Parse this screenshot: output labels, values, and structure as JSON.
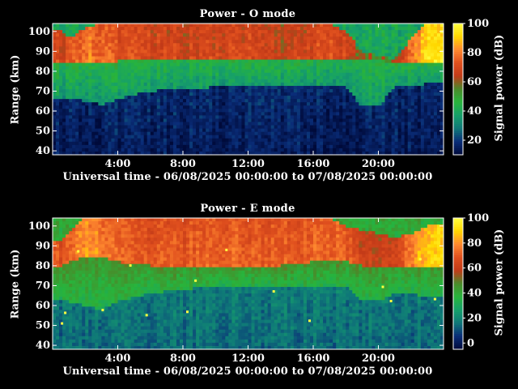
{
  "chart_data": [
    {
      "type": "heatmap",
      "title": "Power - O mode",
      "xlabel": "Universal time - 06/08/2025 00:00:00 to 07/08/2025 00:00:00",
      "ylabel": "Range (km)",
      "colorbar_label": "Signal power (dB)",
      "x_ticks": [
        "4:00",
        "8:00",
        "12:00",
        "16:00",
        "20:00"
      ],
      "x_tick_hours": [
        4,
        8,
        12,
        16,
        20
      ],
      "xlim_hours": [
        0,
        24
      ],
      "y_ticks": [
        40,
        50,
        60,
        70,
        80,
        90,
        100
      ],
      "ylim": [
        38,
        104
      ],
      "colorbar_ticks": [
        20,
        40,
        60,
        80,
        100
      ],
      "colorbar_range": [
        10,
        100
      ],
      "colormap": [
        "#000a3a",
        "#0a2d78",
        "#0f7878",
        "#16a06a",
        "#28b43c",
        "#4a8a2a",
        "#c23a18",
        "#e0501e",
        "#ff8a30",
        "#ffd700",
        "#ffff40"
      ],
      "profile": {
        "hours": [
          0.5,
          1,
          2,
          3,
          4,
          6,
          8,
          10,
          12,
          14,
          16,
          17,
          18,
          19,
          20,
          21,
          22,
          23,
          23.5
        ],
        "top_km": [
          100,
          96,
          102,
          104,
          104,
          104,
          104,
          104,
          104,
          104,
          104,
          104,
          100,
          90,
          88,
          86,
          96,
          104,
          104
        ],
        "base_km": [
          84,
          84,
          84,
          84,
          85,
          86,
          86,
          86,
          86,
          86,
          86,
          86,
          86,
          86,
          86,
          84,
          84,
          84,
          84
        ],
        "transition_km": [
          66,
          66,
          65,
          63,
          66,
          70,
          71,
          72,
          72,
          72,
          72,
          72,
          72,
          62,
          62,
          72,
          72,
          74,
          74
        ],
        "peak_db": [
          70,
          72,
          80,
          78,
          72,
          70,
          68,
          70,
          70,
          66,
          70,
          74,
          70,
          58,
          56,
          60,
          78,
          95,
          95
        ]
      }
    },
    {
      "type": "heatmap",
      "title": "Power - E mode",
      "xlabel": "Universal time - 06/08/2025 00:00:00 to 07/08/2025 00:00:00",
      "ylabel": "Range (km)",
      "colorbar_label": "Signal power (dB)",
      "x_ticks": [
        "4:00",
        "8:00",
        "12:00",
        "16:00",
        "20:00"
      ],
      "x_tick_hours": [
        4,
        8,
        12,
        16,
        20
      ],
      "xlim_hours": [
        0,
        24
      ],
      "y_ticks": [
        40,
        50,
        60,
        70,
        80,
        90,
        100
      ],
      "ylim": [
        38,
        104
      ],
      "colorbar_ticks": [
        0,
        20,
        40,
        60,
        80,
        100
      ],
      "colorbar_range": [
        -5,
        100
      ],
      "colormap": [
        "#000a3a",
        "#0a2d78",
        "#0f7878",
        "#16a06a",
        "#28b43c",
        "#4a8a2a",
        "#c23a18",
        "#e0501e",
        "#ff8a30",
        "#ffd700",
        "#ffff40"
      ],
      "profile": {
        "hours": [
          0.5,
          1,
          2,
          3,
          4,
          6,
          8,
          10,
          12,
          14,
          16,
          17,
          18,
          19,
          20,
          21,
          22,
          23,
          23.5
        ],
        "top_km": [
          92,
          96,
          104,
          104,
          104,
          104,
          104,
          104,
          104,
          104,
          104,
          104,
          100,
          98,
          96,
          94,
          96,
          100,
          100
        ],
        "base_km": [
          80,
          82,
          84,
          84,
          82,
          80,
          80,
          80,
          80,
          80,
          82,
          82,
          82,
          80,
          80,
          80,
          80,
          80,
          80
        ],
        "transition_km": [
          62,
          62,
          60,
          58,
          62,
          66,
          68,
          70,
          70,
          70,
          70,
          70,
          70,
          62,
          62,
          66,
          66,
          64,
          64
        ],
        "peak_db": [
          70,
          72,
          82,
          78,
          72,
          70,
          70,
          72,
          72,
          70,
          72,
          74,
          72,
          62,
          60,
          64,
          78,
          90,
          90
        ]
      },
      "speckle_hours": [
        0.5,
        0.7,
        1.5,
        3.0,
        4.7,
        5.7,
        8.2,
        8.7,
        10.6,
        13.5,
        15.7,
        20.2,
        20.7,
        22.5,
        23.4
      ]
    }
  ]
}
